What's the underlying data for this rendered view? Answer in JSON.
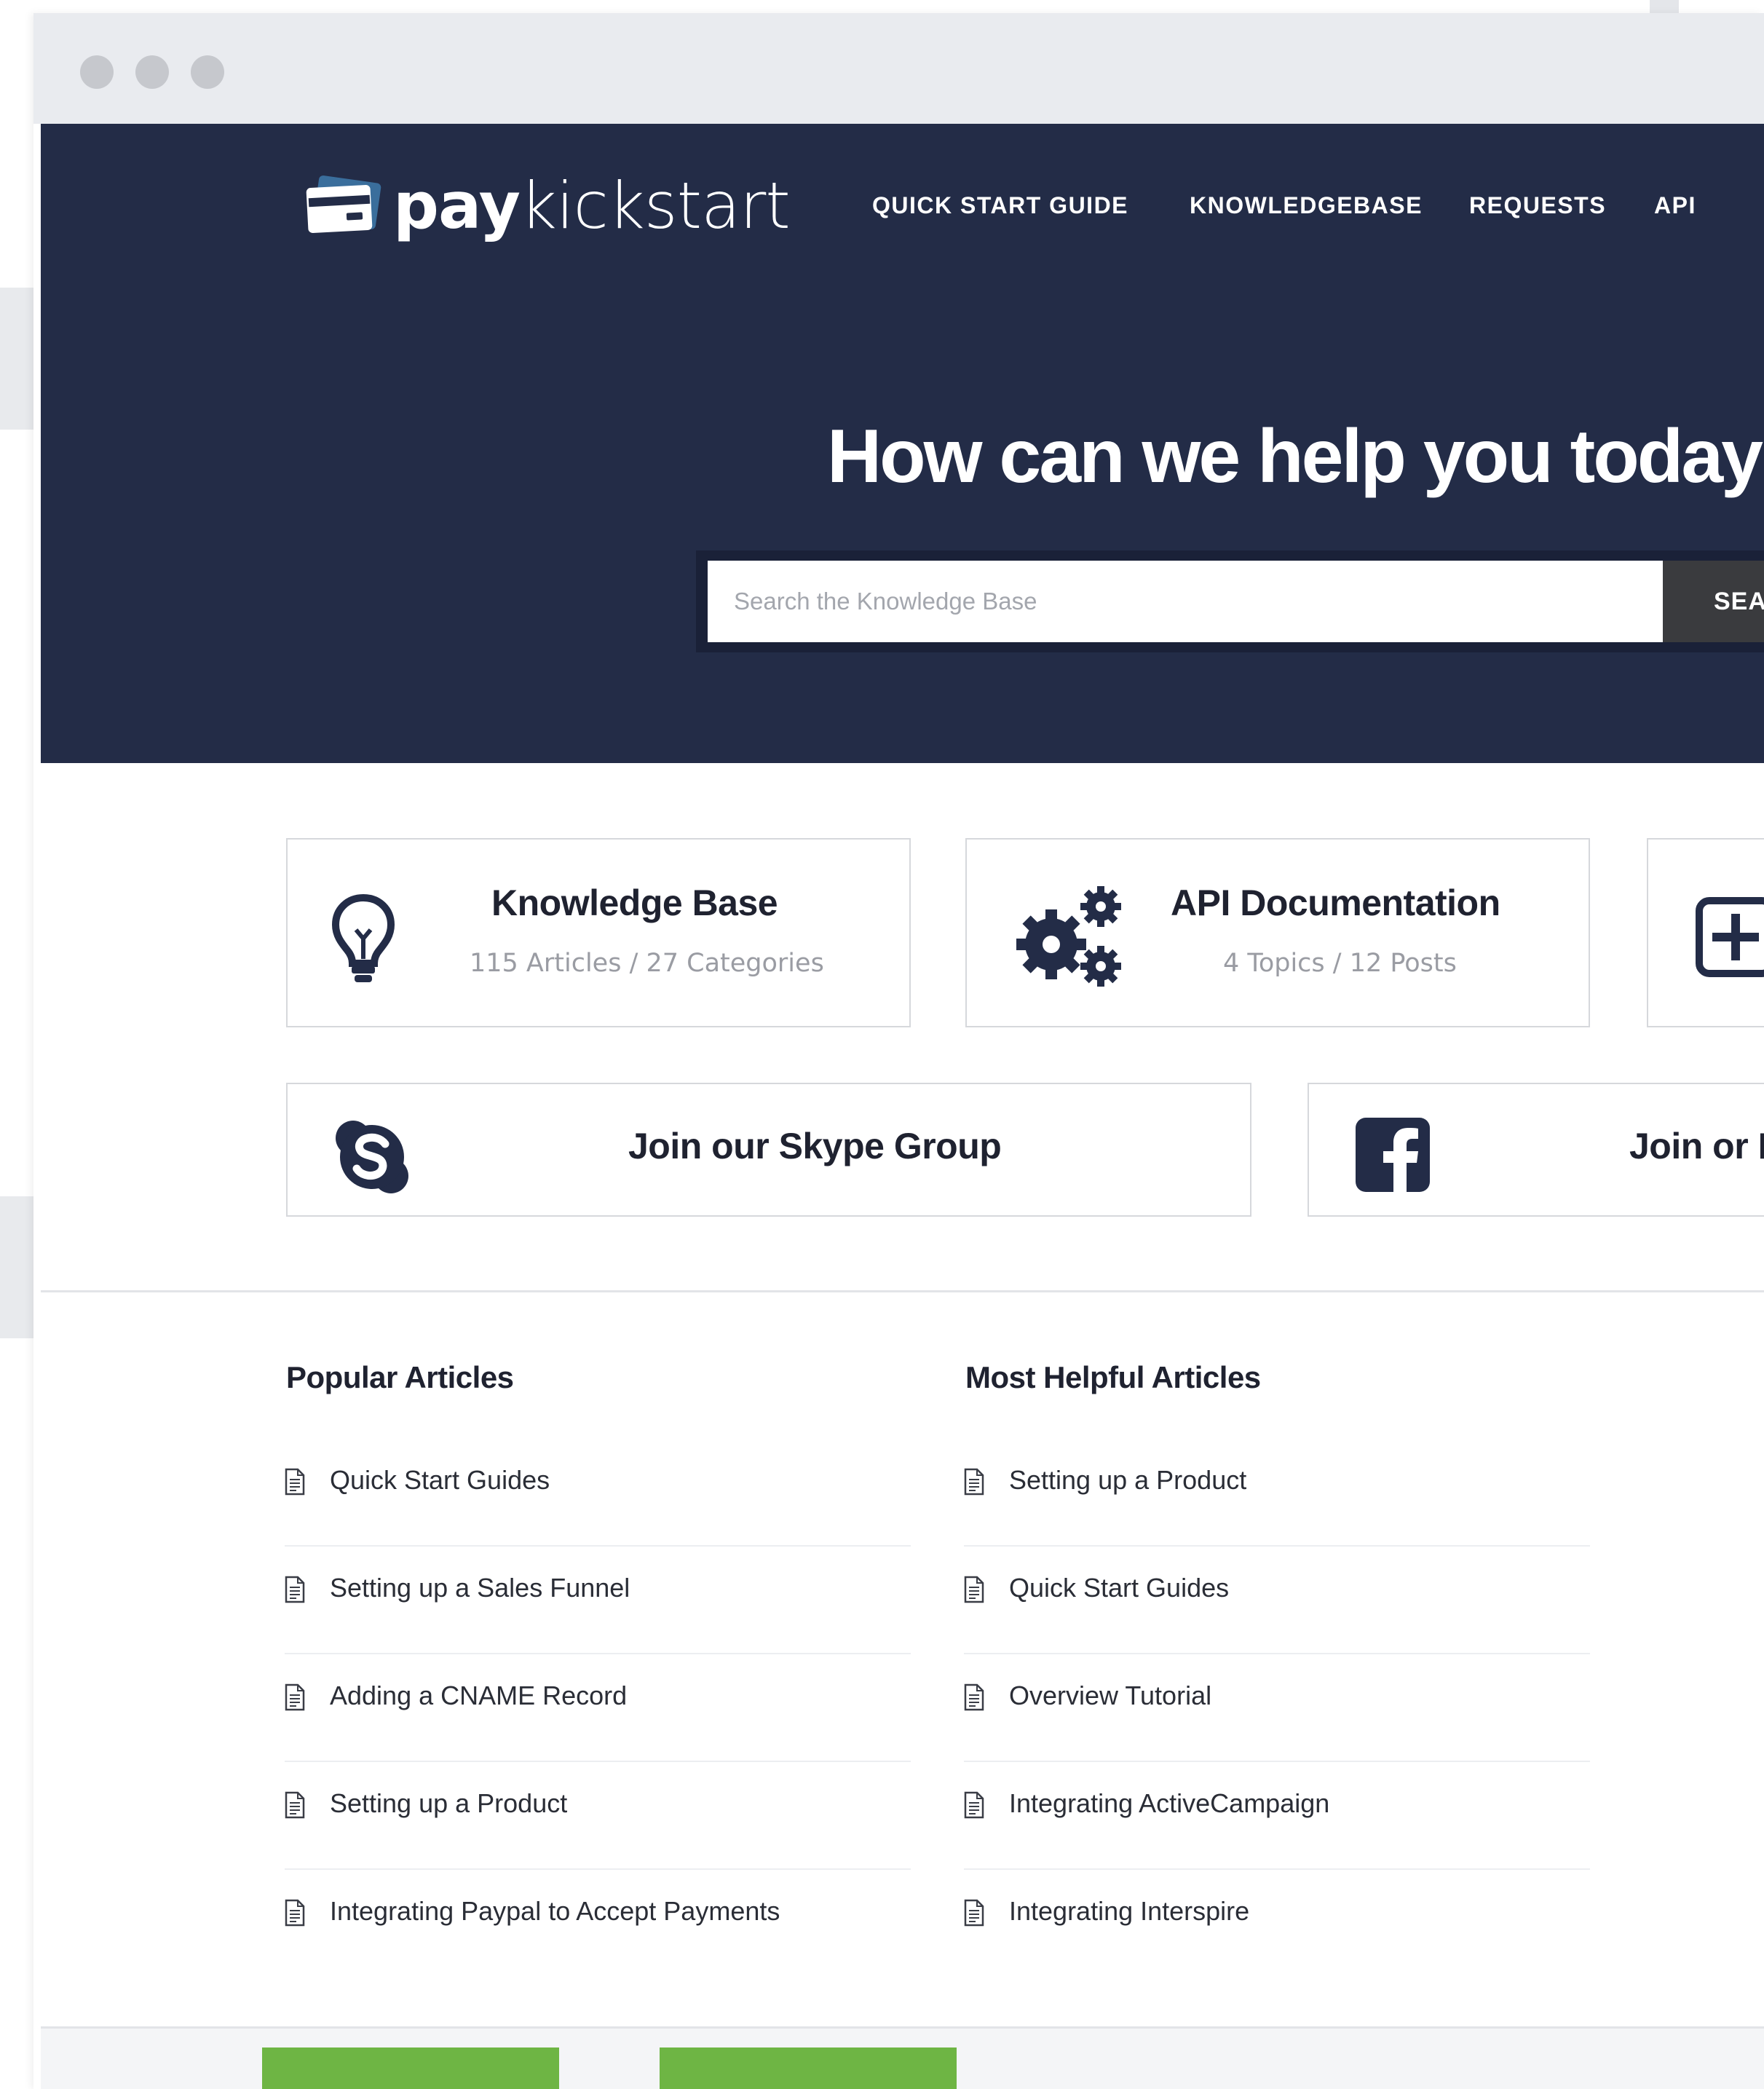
{
  "brand": {
    "name_bold": "pay",
    "name_light": "kickstart"
  },
  "nav": {
    "items": [
      {
        "label": "QUICK START GUIDE"
      },
      {
        "label": "KNOWLEDGEBASE"
      },
      {
        "label": "REQUESTS"
      },
      {
        "label": "API"
      }
    ]
  },
  "hero": {
    "title": "How can we help you today?",
    "search_placeholder": "Search the Knowledge Base",
    "search_button": "SEARCH"
  },
  "cards": {
    "knowledge_base": {
      "title": "Knowledge Base",
      "subtitle": "115 Articles / 27 Categories",
      "icon": "lightbulb-icon"
    },
    "api_docs": {
      "title": "API Documentation",
      "subtitle": "4 Topics / 12 Posts",
      "icon": "gears-icon"
    },
    "third": {
      "icon": "plus-square-icon"
    },
    "skype": {
      "title": "Join our Skype Group",
      "icon": "skype-icon"
    },
    "facebook": {
      "title": "Join or Facebook Group",
      "icon": "facebook-icon"
    }
  },
  "popular": {
    "heading": "Popular Articles",
    "items": [
      {
        "label": "Quick Start Guides"
      },
      {
        "label": "Setting up a Sales Funnel"
      },
      {
        "label": "Adding a CNAME Record"
      },
      {
        "label": "Setting up a Product"
      },
      {
        "label": "Integrating Paypal to Accept Payments"
      }
    ]
  },
  "helpful": {
    "heading": "Most Helpful Articles",
    "items": [
      {
        "label": "Setting up a Product"
      },
      {
        "label": "Quick Start Guides"
      },
      {
        "label": "Overview Tutorial"
      },
      {
        "label": "Integrating ActiveCampaign"
      },
      {
        "label": "Integrating Interspire"
      }
    ]
  },
  "colors": {
    "hero_bg": "#232c47",
    "card_border": "#d6d8dc",
    "accent_green": "#6eb544",
    "search_button_bg": "#3a3b3e"
  }
}
